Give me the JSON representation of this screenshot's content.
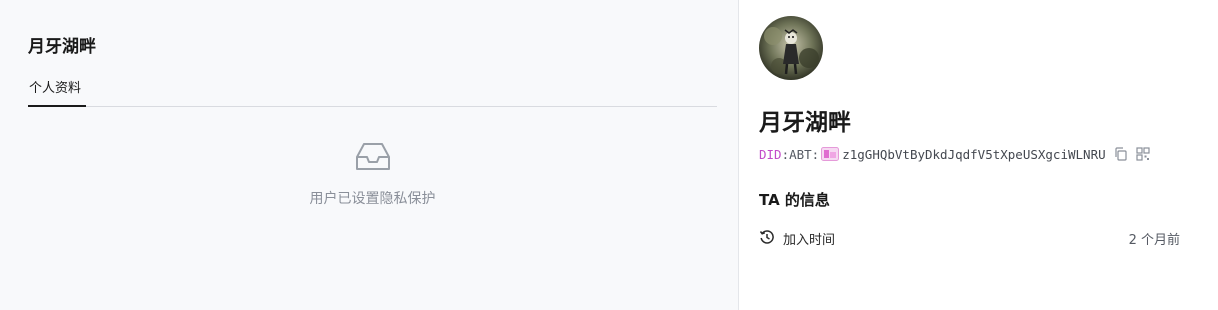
{
  "left": {
    "title": "月牙湖畔",
    "tabs": [
      {
        "label": "个人资料",
        "active": true
      }
    ],
    "empty_state": {
      "icon": "inbox-icon",
      "text": "用户已设置隐私保护"
    }
  },
  "profile": {
    "avatar": "avatar-image",
    "name": "月牙湖畔",
    "did": {
      "prefix": "DID",
      "chain": ":ABT:",
      "address": "z1gGHQbVtByDkdJqdfV5tXpeUSXgciWLNRU",
      "copy_icon": "copy-icon",
      "qr_icon": "qr-code-icon"
    },
    "info_title": "TA 的信息",
    "info": [
      {
        "icon": "history-clock-icon",
        "label": "加入时间",
        "value": "2 个月前"
      }
    ]
  },
  "colors": {
    "left_bg": "#f8f9fb",
    "right_bg": "#ffffff",
    "did_prefix": "#c24bc9",
    "muted": "#8a8f99"
  }
}
